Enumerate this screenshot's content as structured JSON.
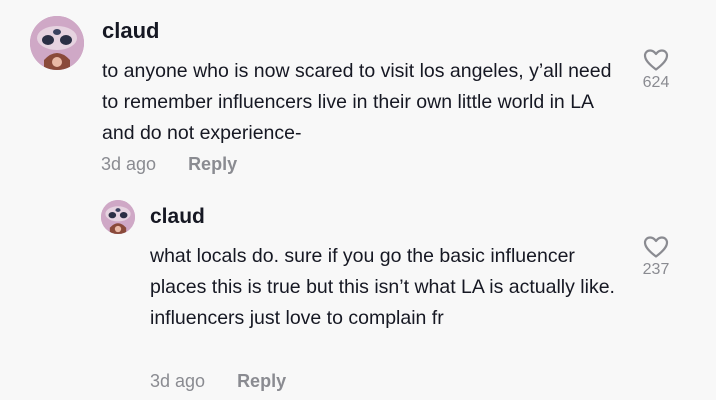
{
  "comments": [
    {
      "username": "claud",
      "text": "to anyone who is now scared to visit los angeles, y’all need to remember influencers live in their own little world in LA and do not experience-",
      "time": "3d ago",
      "reply_label": "Reply",
      "like_count": "624",
      "like_icon": "heart-outline-icon"
    },
    {
      "username": "claud",
      "text": "what locals do. sure if you go the basic influencer places this is true but this isn’t what LA is actually like. influencers just love to complain fr",
      "time": "3d ago",
      "reply_label": "Reply",
      "like_count": "237",
      "like_icon": "heart-outline-icon"
    }
  ],
  "colors": {
    "background": "#f8f8f8",
    "text": "#161823",
    "muted": "#8a8b91"
  }
}
